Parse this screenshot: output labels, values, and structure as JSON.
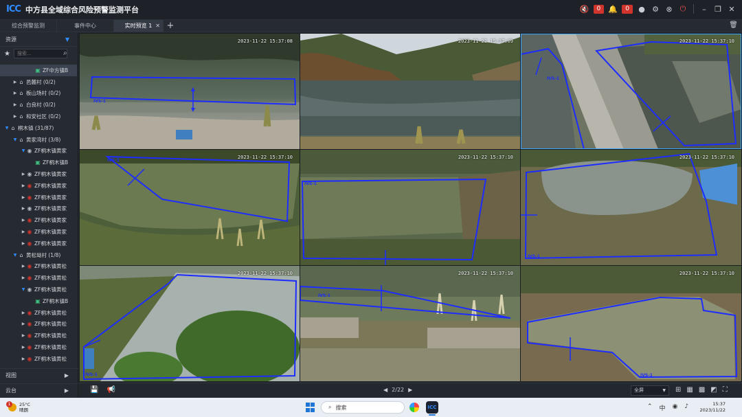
{
  "app": {
    "logo": "ICC",
    "title": "中方县全域综合风险预警监测平台",
    "speaker_count": "0",
    "alarm_count": "0"
  },
  "tabs": [
    {
      "label": "综合预警监测"
    },
    {
      "label": "事件中心"
    },
    {
      "label": "实时预览 1"
    }
  ],
  "sidebar": {
    "section": "资源",
    "search_placeholder": "搜索...",
    "tree": [
      {
        "label": "ZF中方镇B",
        "depth": 3,
        "arrow": "",
        "icon": "chan",
        "selected": true
      },
      {
        "label": "邑麓村 (0/2)",
        "depth": 1,
        "arrow": "closed",
        "icon": "home"
      },
      {
        "label": "板山场村 (0/2)",
        "depth": 1,
        "arrow": "closed",
        "icon": "home"
      },
      {
        "label": "白良村 (0/2)",
        "depth": 1,
        "arrow": "closed",
        "icon": "home"
      },
      {
        "label": "和安社区 (0/2)",
        "depth": 1,
        "arrow": "closed",
        "icon": "home"
      },
      {
        "label": "桐木镇 (31/87)",
        "depth": 0,
        "arrow": "open",
        "icon": "home"
      },
      {
        "label": "黄家湾村 (3/8)",
        "depth": 1,
        "arrow": "open",
        "icon": "home"
      },
      {
        "label": "ZF桐木镇黄家",
        "depth": 2,
        "arrow": "open",
        "icon": "camg"
      },
      {
        "label": "ZF桐木镇B",
        "depth": 3,
        "arrow": "",
        "icon": "chan"
      },
      {
        "label": "ZF桐木镇黄家",
        "depth": 2,
        "arrow": "closed",
        "icon": "camg"
      },
      {
        "label": "ZF桐木镇黄家",
        "depth": 2,
        "arrow": "closed",
        "icon": "cam"
      },
      {
        "label": "ZF桐木镇黄家",
        "depth": 2,
        "arrow": "closed",
        "icon": "cam"
      },
      {
        "label": "ZF桐木镇黄家",
        "depth": 2,
        "arrow": "closed",
        "icon": "camg"
      },
      {
        "label": "ZF桐木镇黄家",
        "depth": 2,
        "arrow": "closed",
        "icon": "cam"
      },
      {
        "label": "ZF桐木镇黄家",
        "depth": 2,
        "arrow": "closed",
        "icon": "cam"
      },
      {
        "label": "ZF桐木镇黄家",
        "depth": 2,
        "arrow": "closed",
        "icon": "cam"
      },
      {
        "label": "黄松坳村 (1/8)",
        "depth": 1,
        "arrow": "open",
        "icon": "home"
      },
      {
        "label": "ZF桐木镇黄松",
        "depth": 2,
        "arrow": "closed",
        "icon": "cam"
      },
      {
        "label": "ZF桐木镇黄松",
        "depth": 2,
        "arrow": "closed",
        "icon": "cam"
      },
      {
        "label": "ZF桐木镇黄松",
        "depth": 2,
        "arrow": "open",
        "icon": "camg"
      },
      {
        "label": "ZF桐木镇B",
        "depth": 3,
        "arrow": "",
        "icon": "chan"
      },
      {
        "label": "ZF桐木镇黄松",
        "depth": 2,
        "arrow": "closed",
        "icon": "cam"
      },
      {
        "label": "ZF桐木镇黄松",
        "depth": 2,
        "arrow": "closed",
        "icon": "cam"
      },
      {
        "label": "ZF桐木镇黄松",
        "depth": 2,
        "arrow": "closed",
        "icon": "cam"
      },
      {
        "label": "ZF桐木镇黄松",
        "depth": 2,
        "arrow": "closed",
        "icon": "cam"
      },
      {
        "label": "ZF桐木镇黄松",
        "depth": 2,
        "arrow": "closed",
        "icon": "cam"
      }
    ],
    "view_label": "视图",
    "ptz_label": "云台"
  },
  "cameras": [
    {
      "timestamp": "2023-11-22 15:37:08",
      "rule": "IVS-1",
      "scene": "pond"
    },
    {
      "timestamp": "2023-11-22 15:37:09",
      "rule": "",
      "scene": "lake"
    },
    {
      "timestamp": "2023-11-22 15:37:10",
      "rule": "IVS-1",
      "scene": "dam"
    },
    {
      "timestamp": "2023-11-22 15:37:10",
      "rule": "IVS-1",
      "scene": "pond2"
    },
    {
      "timestamp": "2023-11-22 15:37:10",
      "rule": "IVS-1",
      "scene": "pond3"
    },
    {
      "timestamp": "2023-11-22 15:37:10",
      "rule": "IVS-1",
      "scene": "pond4"
    },
    {
      "timestamp": "2023-11-22 15:37:10",
      "rule": "IVS-1",
      "scene": "pond5"
    },
    {
      "timestamp": "2023-11-22 15:37:10",
      "rule": "IVS-1",
      "scene": "pond6"
    },
    {
      "timestamp": "2023-11-22 15:37:10",
      "rule": "IVS-1",
      "scene": "pond7"
    }
  ],
  "toolbar": {
    "page": "2/22",
    "screen_mode": "全屏"
  },
  "taskbar": {
    "weather_temp": "25°C",
    "weather_desc": "晴朗",
    "weather_alert": "1",
    "search_label": "搜索",
    "icc_label": "ICC",
    "time": "15:37",
    "date": "2023/11/22"
  }
}
